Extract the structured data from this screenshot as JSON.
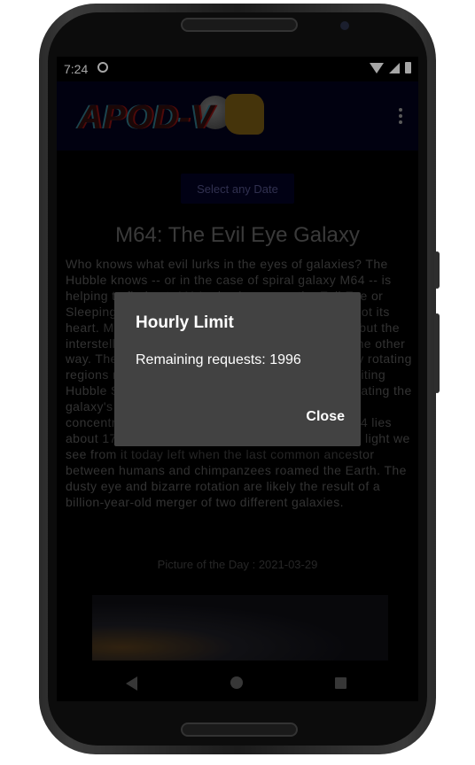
{
  "status_bar": {
    "time": "7:24"
  },
  "app": {
    "logo_text": "APOD-V",
    "date_button_label": "Select any Date",
    "title": "M64: The Evil Eye Galaxy",
    "description": "Who knows what evil lurks in the eyes of galaxies? The Hubble knows -- or in the case of spiral galaxy M64 -- is helping to find out. M64, also known as the Evil Eye or Sleeping Beauty galaxy, may have evil in its eye, not its heart. Most of its stars orbit in the same direction, but the interstellar gas in the outer regions of M64 orbits the other way. The central region is where the two oppositely rotating regions meet. The above image from the Earth-orbiting Hubble Space Telescope shows dust clouds dominating the galaxy's central region, which also harbors dense concentrations of hydrogen gas and new stars. M64 lies about 17 million light years away, meaning that the light we see from it today left when the last common ancestor between humans and chimpanzees roamed the Earth.  The dusty eye and bizarre rotation are likely the result of a billion-year-old merger of two different galaxies.",
    "picture_caption": "Picture of the Day : 2021-03-29"
  },
  "dialog": {
    "title": "Hourly Limit",
    "message": "Remaining requests: 1996",
    "close_label": "Close"
  },
  "icons": {
    "overflow_menu": "more-vert-icon",
    "back": "back-icon",
    "home": "home-icon",
    "recents": "recents-icon"
  }
}
